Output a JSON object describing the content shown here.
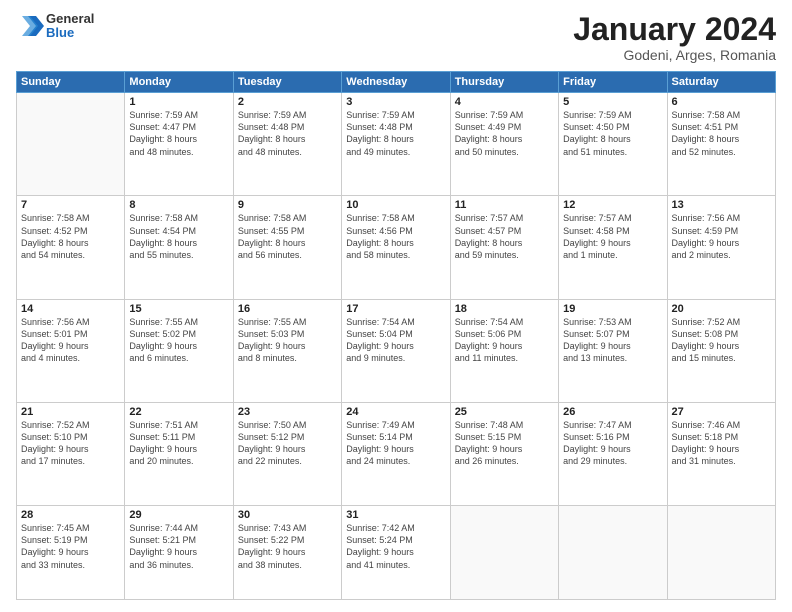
{
  "logo": {
    "general": "General",
    "blue": "Blue"
  },
  "title": "January 2024",
  "location": "Godeni, Arges, Romania",
  "days_of_week": [
    "Sunday",
    "Monday",
    "Tuesday",
    "Wednesday",
    "Thursday",
    "Friday",
    "Saturday"
  ],
  "weeks": [
    [
      {
        "day": "",
        "info": ""
      },
      {
        "day": "1",
        "info": "Sunrise: 7:59 AM\nSunset: 4:47 PM\nDaylight: 8 hours\nand 48 minutes."
      },
      {
        "day": "2",
        "info": "Sunrise: 7:59 AM\nSunset: 4:48 PM\nDaylight: 8 hours\nand 48 minutes."
      },
      {
        "day": "3",
        "info": "Sunrise: 7:59 AM\nSunset: 4:48 PM\nDaylight: 8 hours\nand 49 minutes."
      },
      {
        "day": "4",
        "info": "Sunrise: 7:59 AM\nSunset: 4:49 PM\nDaylight: 8 hours\nand 50 minutes."
      },
      {
        "day": "5",
        "info": "Sunrise: 7:59 AM\nSunset: 4:50 PM\nDaylight: 8 hours\nand 51 minutes."
      },
      {
        "day": "6",
        "info": "Sunrise: 7:58 AM\nSunset: 4:51 PM\nDaylight: 8 hours\nand 52 minutes."
      }
    ],
    [
      {
        "day": "7",
        "info": "Sunrise: 7:58 AM\nSunset: 4:52 PM\nDaylight: 8 hours\nand 54 minutes."
      },
      {
        "day": "8",
        "info": "Sunrise: 7:58 AM\nSunset: 4:54 PM\nDaylight: 8 hours\nand 55 minutes."
      },
      {
        "day": "9",
        "info": "Sunrise: 7:58 AM\nSunset: 4:55 PM\nDaylight: 8 hours\nand 56 minutes."
      },
      {
        "day": "10",
        "info": "Sunrise: 7:58 AM\nSunset: 4:56 PM\nDaylight: 8 hours\nand 58 minutes."
      },
      {
        "day": "11",
        "info": "Sunrise: 7:57 AM\nSunset: 4:57 PM\nDaylight: 8 hours\nand 59 minutes."
      },
      {
        "day": "12",
        "info": "Sunrise: 7:57 AM\nSunset: 4:58 PM\nDaylight: 9 hours\nand 1 minute."
      },
      {
        "day": "13",
        "info": "Sunrise: 7:56 AM\nSunset: 4:59 PM\nDaylight: 9 hours\nand 2 minutes."
      }
    ],
    [
      {
        "day": "14",
        "info": "Sunrise: 7:56 AM\nSunset: 5:01 PM\nDaylight: 9 hours\nand 4 minutes."
      },
      {
        "day": "15",
        "info": "Sunrise: 7:55 AM\nSunset: 5:02 PM\nDaylight: 9 hours\nand 6 minutes."
      },
      {
        "day": "16",
        "info": "Sunrise: 7:55 AM\nSunset: 5:03 PM\nDaylight: 9 hours\nand 8 minutes."
      },
      {
        "day": "17",
        "info": "Sunrise: 7:54 AM\nSunset: 5:04 PM\nDaylight: 9 hours\nand 9 minutes."
      },
      {
        "day": "18",
        "info": "Sunrise: 7:54 AM\nSunset: 5:06 PM\nDaylight: 9 hours\nand 11 minutes."
      },
      {
        "day": "19",
        "info": "Sunrise: 7:53 AM\nSunset: 5:07 PM\nDaylight: 9 hours\nand 13 minutes."
      },
      {
        "day": "20",
        "info": "Sunrise: 7:52 AM\nSunset: 5:08 PM\nDaylight: 9 hours\nand 15 minutes."
      }
    ],
    [
      {
        "day": "21",
        "info": "Sunrise: 7:52 AM\nSunset: 5:10 PM\nDaylight: 9 hours\nand 17 minutes."
      },
      {
        "day": "22",
        "info": "Sunrise: 7:51 AM\nSunset: 5:11 PM\nDaylight: 9 hours\nand 20 minutes."
      },
      {
        "day": "23",
        "info": "Sunrise: 7:50 AM\nSunset: 5:12 PM\nDaylight: 9 hours\nand 22 minutes."
      },
      {
        "day": "24",
        "info": "Sunrise: 7:49 AM\nSunset: 5:14 PM\nDaylight: 9 hours\nand 24 minutes."
      },
      {
        "day": "25",
        "info": "Sunrise: 7:48 AM\nSunset: 5:15 PM\nDaylight: 9 hours\nand 26 minutes."
      },
      {
        "day": "26",
        "info": "Sunrise: 7:47 AM\nSunset: 5:16 PM\nDaylight: 9 hours\nand 29 minutes."
      },
      {
        "day": "27",
        "info": "Sunrise: 7:46 AM\nSunset: 5:18 PM\nDaylight: 9 hours\nand 31 minutes."
      }
    ],
    [
      {
        "day": "28",
        "info": "Sunrise: 7:45 AM\nSunset: 5:19 PM\nDaylight: 9 hours\nand 33 minutes."
      },
      {
        "day": "29",
        "info": "Sunrise: 7:44 AM\nSunset: 5:21 PM\nDaylight: 9 hours\nand 36 minutes."
      },
      {
        "day": "30",
        "info": "Sunrise: 7:43 AM\nSunset: 5:22 PM\nDaylight: 9 hours\nand 38 minutes."
      },
      {
        "day": "31",
        "info": "Sunrise: 7:42 AM\nSunset: 5:24 PM\nDaylight: 9 hours\nand 41 minutes."
      },
      {
        "day": "",
        "info": ""
      },
      {
        "day": "",
        "info": ""
      },
      {
        "day": "",
        "info": ""
      }
    ]
  ]
}
